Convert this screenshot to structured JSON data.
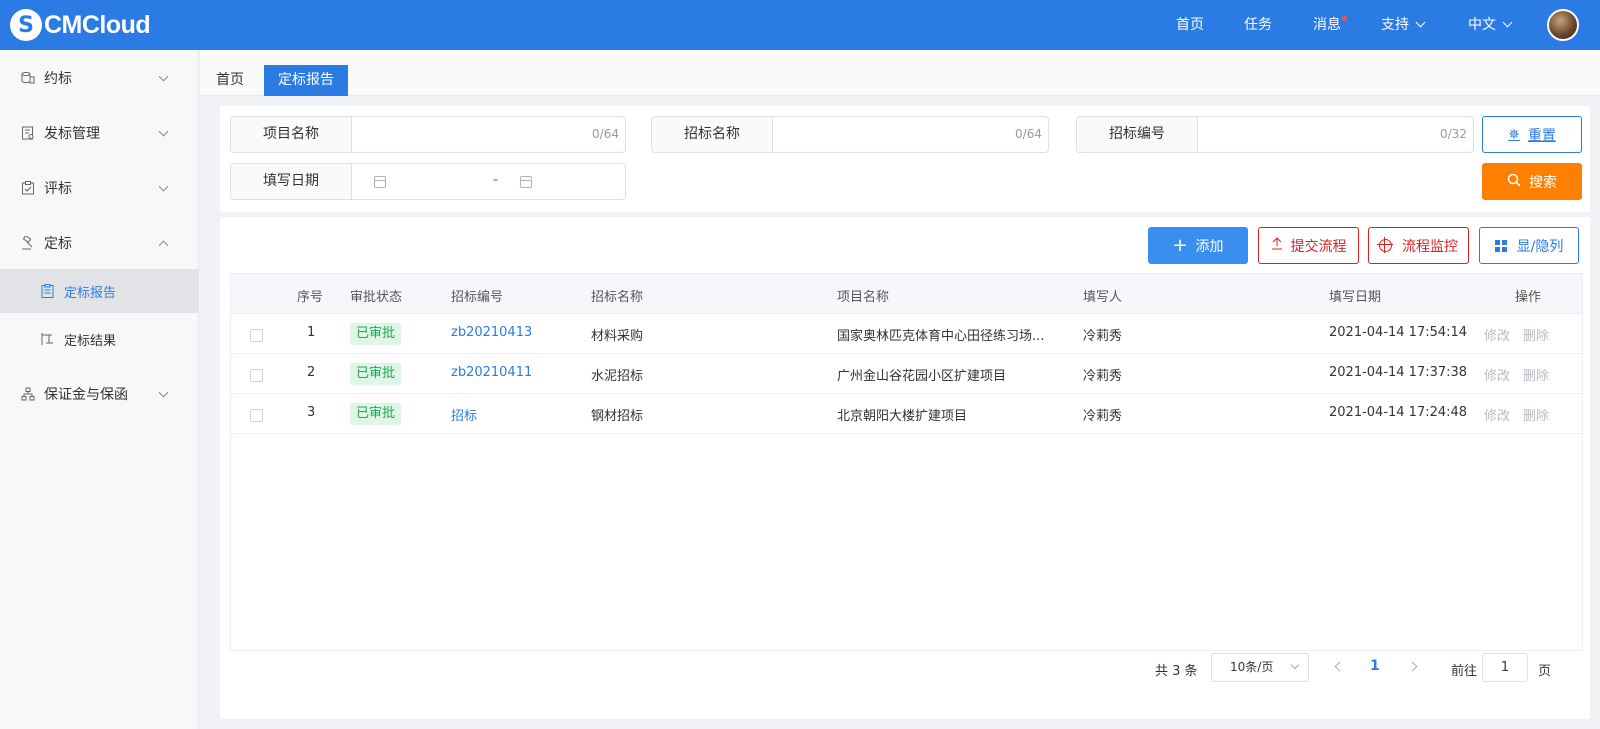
{
  "app": {
    "logo_letter": "S",
    "logo_text": "CMCloud"
  },
  "header": {
    "nav": [
      "首页",
      "任务",
      "消息",
      "支持",
      "中文"
    ]
  },
  "sidebar": {
    "items": [
      {
        "label": "约标",
        "icon": "coins-icon"
      },
      {
        "label": "发标管理",
        "icon": "document-gear-icon"
      },
      {
        "label": "评标",
        "icon": "clipboard-check-icon"
      },
      {
        "label": "定标",
        "icon": "gavel-icon"
      },
      {
        "label": "保证金与保函",
        "icon": "org-chart-icon"
      }
    ],
    "sub_items": [
      {
        "label": "定标报告",
        "icon": "report-icon",
        "active": true
      },
      {
        "label": "定标结果",
        "icon": "result-icon",
        "active": false
      }
    ]
  },
  "tabs": [
    "首页",
    "定标报告"
  ],
  "search": {
    "fields": [
      {
        "label": "项目名称",
        "count": "0/64"
      },
      {
        "label": "招标名称",
        "count": "0/64"
      },
      {
        "label": "招标编号",
        "count": "0/32"
      }
    ],
    "date_label": "填写日期",
    "date_separator": "-",
    "reset_label": "重置",
    "search_label": "搜索"
  },
  "toolbar": {
    "add_label": "添加",
    "submit_label": "提交流程",
    "monitor_label": "流程监控",
    "columns_label": "显/隐列"
  },
  "table": {
    "columns": [
      "序号",
      "审批状态",
      "招标编号",
      "招标名称",
      "项目名称",
      "填写人",
      "填写日期",
      "操作"
    ],
    "rows": [
      {
        "index": "1",
        "status": "已审批",
        "code": "zb20210413",
        "tender": "材料采购",
        "project": "国家奥林匹克体育中心田径练习场...",
        "author": "冷莉秀",
        "date": "2021-04-14 17:54:14",
        "edit": "修改",
        "delete": "删除"
      },
      {
        "index": "2",
        "status": "已审批",
        "code": "zb20210411",
        "tender": "水泥招标",
        "project": "广州金山谷花园小区扩建项目",
        "author": "冷莉秀",
        "date": "2021-04-14 17:37:38",
        "edit": "修改",
        "delete": "删除"
      },
      {
        "index": "3",
        "status": "已审批",
        "code": "招标",
        "tender": "钢材招标",
        "project": "北京朝阳大楼扩建项目",
        "author": "冷莉秀",
        "date": "2021-04-14 17:24:48",
        "edit": "修改",
        "delete": "删除"
      }
    ]
  },
  "pagination": {
    "total": "共 3 条",
    "page_size": "10条/页",
    "current_page": "1",
    "goto_label": "前往",
    "goto_value": "1",
    "goto_unit": "页"
  },
  "colors": {
    "primary": "#2b7be5",
    "search_orange": "#ff8000",
    "danger_red": "#e02020",
    "approved_green": "#1aab56"
  }
}
